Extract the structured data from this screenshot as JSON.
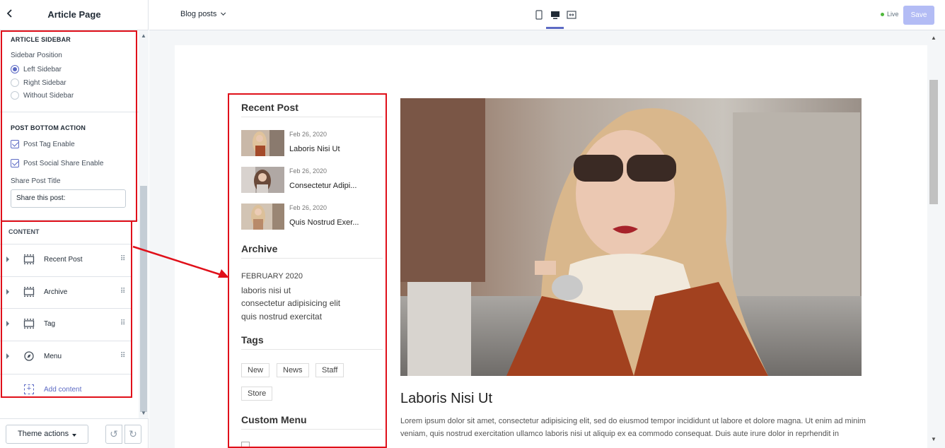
{
  "left_panel": {
    "title": "Article Page",
    "article_sidebar": {
      "heading": "ARTICLE SIDEBAR",
      "position_label": "Sidebar Position",
      "options": [
        "Left Sidebar",
        "Right Sidebar",
        "Without Sidebar"
      ],
      "selected": "Left Sidebar"
    },
    "post_bottom": {
      "heading": "POST BOTTOM ACTION",
      "tag_enable": "Post Tag Enable",
      "social_enable": "Post Social Share Enable",
      "share_title_label": "Share Post Title",
      "share_title_value": "Share this post:"
    },
    "content": {
      "heading": "CONTENT",
      "blocks": [
        "Recent Post",
        "Archive",
        "Tag",
        "Menu"
      ],
      "add_label": "Add content"
    },
    "footer": {
      "theme_actions": "Theme actions"
    }
  },
  "topbar": {
    "page_select": "Blog posts",
    "status": "Live",
    "save_label": "Save"
  },
  "preview": {
    "recent_post_heading": "Recent Post",
    "recent_posts": [
      {
        "date": "Feb 26, 2020",
        "title": "Laboris Nisi Ut"
      },
      {
        "date": "Feb 26, 2020",
        "title": "Consectetur Adipi..."
      },
      {
        "date": "Feb 26, 2020",
        "title": "Quis Nostrud Exer..."
      }
    ],
    "archive_heading": "Archive",
    "archive_month": "FEBRUARY 2020",
    "archive_links": [
      "laboris nisi ut",
      "consectetur adipisicing elit",
      "quis nostrud exercitat"
    ],
    "tags_heading": "Tags",
    "tags": [
      "New",
      "News",
      "Staff",
      "Store"
    ],
    "custom_menu_heading": "Custom Menu",
    "post_title": "Laboris Nisi Ut",
    "post_body": "Lorem ipsum dolor sit amet, consectetur adipisicing elit, sed do eiusmod tempor incididunt ut labore et dolore magna. Ut enim ad minim veniam, quis nostrud exercitation ullamco laboris nisi ut aliquip ex ea commodo consequat. Duis aute irure dolor in reprhendit in voluptate velit esse cillum dolore eu fugiat nulla pariatur. Excepteur sint occaecat cupidatat non proident, sunt in culpa qui officia deserunt."
  },
  "colors": {
    "accent": "#5c6ac4",
    "highlight": "#e0101a",
    "live": "#50b83c"
  }
}
